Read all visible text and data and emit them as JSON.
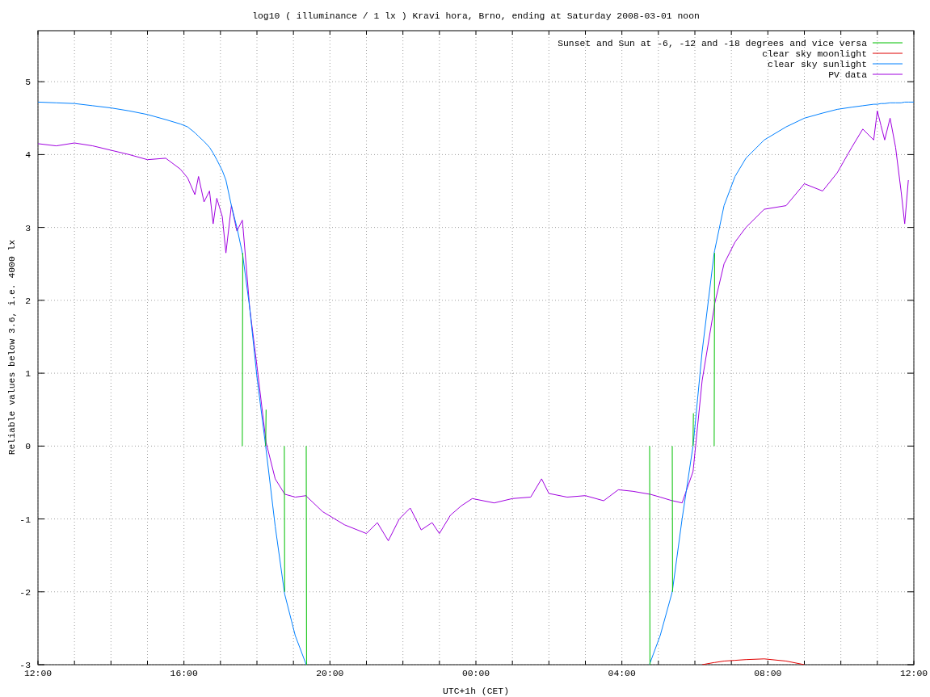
{
  "chart_data": {
    "type": "line",
    "title": "log10 ( illuminance / 1 lx ) Kravi hora, Brno, ending at Saturday 2008-03-01 noon",
    "xlabel": "UTC+1h (CET)",
    "ylabel": "Reliable values below 3.6, i.e. 4000 lx",
    "grid": true,
    "legend": "top-right",
    "xlim": [
      "2008-02-29T12:00",
      "2008-03-01T12:00"
    ],
    "ylim": [
      -3,
      5.7
    ],
    "xticks": [
      {
        "value": "2008-02-29T12:00",
        "label": "12:00"
      },
      {
        "value": "2008-02-29T16:00",
        "label": "16:00"
      },
      {
        "value": "2008-02-29T20:00",
        "label": "20:00"
      },
      {
        "value": "2008-03-01T00:00",
        "label": "00:00"
      },
      {
        "value": "2008-03-01T04:00",
        "label": "04:00"
      },
      {
        "value": "2008-03-01T08:00",
        "label": "08:00"
      },
      {
        "value": "2008-03-01T12:00",
        "label": "12:00"
      }
    ],
    "yticks": [
      -3,
      -2,
      -1,
      0,
      1,
      2,
      3,
      4,
      5
    ],
    "x": [
      "2008-02-29T12:00",
      "2008-02-29T12:30",
      "2008-02-29T13:00",
      "2008-02-29T13:30",
      "2008-02-29T14:00",
      "2008-02-29T14:30",
      "2008-02-29T15:00",
      "2008-02-29T15:30",
      "2008-02-29T15:54",
      "2008-02-29T16:06",
      "2008-02-29T16:18",
      "2008-02-29T16:24",
      "2008-02-29T16:33",
      "2008-02-29T16:42",
      "2008-02-29T16:48",
      "2008-02-29T16:54",
      "2008-02-29T17:03",
      "2008-02-29T17:09",
      "2008-02-29T17:18",
      "2008-02-29T17:27",
      "2008-02-29T17:36",
      "2008-02-29T17:36:36",
      "2008-02-29T17:48",
      "2008-02-29T18:00",
      "2008-02-29T18:14:24",
      "2008-02-29T18:15",
      "2008-02-29T18:30",
      "2008-02-29T18:45",
      "2008-02-29T18:45:36",
      "2008-02-29T19:03",
      "2008-02-29T19:21",
      "2008-02-29T19:21:36",
      "2008-02-29T19:48",
      "2008-02-29T20:24",
      "2008-02-29T21:00",
      "2008-02-29T21:18",
      "2008-02-29T21:36",
      "2008-02-29T21:54",
      "2008-02-29T22:12",
      "2008-02-29T22:30",
      "2008-02-29T22:48",
      "2008-02-29T23:00",
      "2008-02-29T23:18",
      "2008-02-29T23:36",
      "2008-02-29T23:54",
      "2008-03-01T00:30",
      "2008-03-01T01:00",
      "2008-03-01T01:30",
      "2008-03-01T01:48",
      "2008-03-01T02:00",
      "2008-03-01T02:30",
      "2008-03-01T03:00",
      "2008-03-01T03:30",
      "2008-03-01T03:54",
      "2008-03-01T04:18",
      "2008-03-01T04:45:36",
      "2008-03-01T04:46:12",
      "2008-03-01T05:03",
      "2008-03-01T05:22:48",
      "2008-03-01T05:23:24",
      "2008-03-01T05:39",
      "2008-03-01T05:57",
      "2008-03-01T05:57:36",
      "2008-03-01T06:12",
      "2008-03-01T06:31:48",
      "2008-03-01T06:32:24",
      "2008-03-01T06:48",
      "2008-03-01T07:06",
      "2008-03-01T07:24",
      "2008-03-01T07:54",
      "2008-03-01T08:30",
      "2008-03-01T09:00",
      "2008-03-01T09:30",
      "2008-03-01T09:54",
      "2008-03-01T10:18",
      "2008-03-01T10:36",
      "2008-03-01T10:54",
      "2008-03-01T11:00",
      "2008-03-01T11:06",
      "2008-03-01T11:12",
      "2008-03-01T11:21",
      "2008-03-01T11:30",
      "2008-03-01T11:39",
      "2008-03-01T11:45",
      "2008-03-01T11:51",
      "2008-03-01T12:00"
    ],
    "series": [
      {
        "name": "Sunset and Sun at -6, -12 and -18 degrees and vice versa",
        "color": "#00c000",
        "values": [
          null,
          null,
          null,
          null,
          null,
          null,
          null,
          null,
          null,
          null,
          null,
          null,
          null,
          null,
          null,
          null,
          null,
          null,
          null,
          null,
          0,
          2.65,
          null,
          null,
          0,
          0.5,
          null,
          0,
          -2,
          null,
          0,
          -3,
          null,
          null,
          null,
          null,
          null,
          null,
          null,
          null,
          null,
          null,
          null,
          null,
          null,
          null,
          null,
          null,
          null,
          null,
          null,
          null,
          null,
          null,
          null,
          0,
          -3,
          null,
          0,
          -2,
          null,
          0,
          0.45,
          null,
          0,
          2.65,
          null,
          null,
          null,
          null,
          null,
          null,
          null,
          null,
          null,
          null,
          null,
          null,
          null,
          null,
          null,
          null,
          null,
          null,
          null,
          null
        ]
      },
      {
        "name": "clear sky moonlight",
        "color": "#e00000",
        "values": [
          null,
          null,
          null,
          null,
          null,
          null,
          null,
          null,
          null,
          null,
          null,
          null,
          null,
          null,
          null,
          null,
          null,
          null,
          null,
          null,
          null,
          null,
          null,
          null,
          null,
          null,
          null,
          null,
          null,
          null,
          null,
          null,
          null,
          null,
          null,
          null,
          null,
          null,
          null,
          null,
          null,
          null,
          null,
          null,
          null,
          null,
          null,
          null,
          null,
          null,
          null,
          null,
          null,
          null,
          null,
          null,
          null,
          null,
          null,
          null,
          null,
          null,
          null,
          -3,
          -2.97,
          -2.97,
          -2.95,
          -2.94,
          -2.93,
          -2.92,
          -2.95,
          -3,
          null,
          null,
          null,
          null,
          null,
          null,
          null,
          null,
          null,
          null,
          null,
          null,
          null,
          null
        ]
      },
      {
        "name": "clear sky sunlight",
        "color": "#0080ff",
        "values": [
          4.72,
          4.71,
          4.7,
          4.67,
          4.64,
          4.6,
          4.55,
          4.48,
          4.42,
          4.38,
          4.3,
          4.25,
          4.18,
          4.1,
          4.02,
          3.93,
          3.78,
          3.65,
          3.3,
          3.0,
          2.65,
          2.62,
          1.9,
          0.95,
          0,
          -0.05,
          -1.1,
          -2,
          -2.03,
          -2.6,
          -3,
          null,
          null,
          null,
          null,
          null,
          null,
          null,
          null,
          null,
          null,
          null,
          null,
          null,
          null,
          null,
          null,
          null,
          null,
          null,
          null,
          null,
          null,
          null,
          null,
          -3,
          -2.98,
          -2.6,
          -2,
          -1.97,
          -1.0,
          0,
          0.05,
          1.3,
          2.65,
          2.68,
          3.3,
          3.7,
          3.95,
          4.2,
          4.38,
          4.5,
          4.57,
          4.62,
          4.65,
          4.67,
          4.69,
          4.69,
          4.7,
          4.7,
          4.71,
          4.71,
          4.71,
          4.72,
          4.72,
          4.72
        ]
      },
      {
        "name": "PV data",
        "color": "#a000e0",
        "values": [
          4.15,
          4.12,
          4.16,
          4.12,
          4.06,
          4.0,
          3.93,
          3.95,
          3.8,
          3.68,
          3.45,
          3.7,
          3.35,
          3.5,
          3.05,
          3.4,
          3.15,
          2.65,
          3.3,
          2.95,
          3.1,
          3.05,
          1.9,
          1.1,
          0.1,
          0.05,
          -0.45,
          -0.65,
          -0.66,
          -0.7,
          -0.68,
          -0.69,
          -0.9,
          -1.08,
          -1.2,
          -1.05,
          -1.3,
          -1.0,
          -0.85,
          -1.15,
          -1.05,
          -1.2,
          -0.95,
          -0.82,
          -0.72,
          -0.78,
          -0.72,
          -0.7,
          -0.45,
          -0.65,
          -0.7,
          -0.68,
          -0.75,
          -0.6,
          -0.62,
          -0.66,
          -0.66,
          -0.7,
          -0.75,
          -0.75,
          -0.78,
          -0.35,
          -0.3,
          0.9,
          1.9,
          1.95,
          2.5,
          2.8,
          3.0,
          3.25,
          3.3,
          3.6,
          3.5,
          3.75,
          4.1,
          4.35,
          4.2,
          4.6,
          4.4,
          4.2,
          4.5,
          4.1,
          3.5,
          3.05,
          3.65,
          null
        ]
      }
    ]
  }
}
